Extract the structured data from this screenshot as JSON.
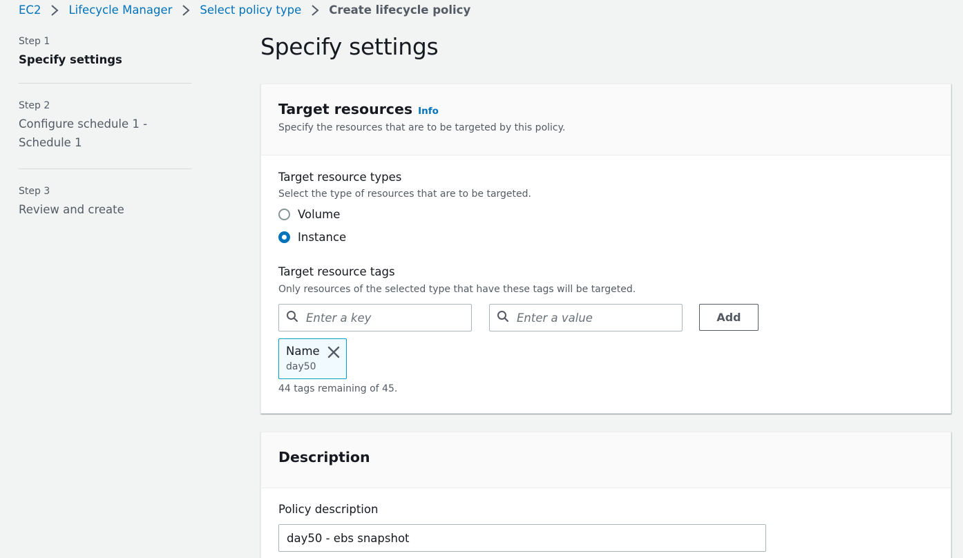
{
  "breadcrumb": {
    "items": [
      "EC2",
      "Lifecycle Manager",
      "Select policy type"
    ],
    "current": "Create lifecycle policy"
  },
  "steps": [
    {
      "number": "Step 1",
      "title": "Specify settings",
      "active": true
    },
    {
      "number": "Step 2",
      "title": "Configure schedule 1 - Schedule 1",
      "active": false
    },
    {
      "number": "Step 3",
      "title": "Review and create",
      "active": false
    }
  ],
  "page_title": "Specify settings",
  "target_resources": {
    "title": "Target resources",
    "info": "Info",
    "description": "Specify the resources that are to be targeted by this policy.",
    "types_label": "Target resource types",
    "types_desc": "Select the type of resources that are to be targeted.",
    "options": [
      "Volume",
      "Instance"
    ],
    "selected": "Instance",
    "tags_label": "Target resource tags",
    "tags_desc": "Only resources of the selected type that have these tags will be targeted.",
    "key_placeholder": "Enter a key",
    "value_placeholder": "Enter a value",
    "add_label": "Add",
    "tag": {
      "key": "Name",
      "value": "day50"
    },
    "remaining": "44 tags remaining of 45."
  },
  "description_panel": {
    "title": "Description",
    "field_label": "Policy description",
    "field_value": "day50 - ebs snapshot"
  },
  "colors": {
    "link": "#0073bb",
    "radio_selected": "#0073bb",
    "token_border": "#00a1c9",
    "background": "#f2f3f3"
  }
}
